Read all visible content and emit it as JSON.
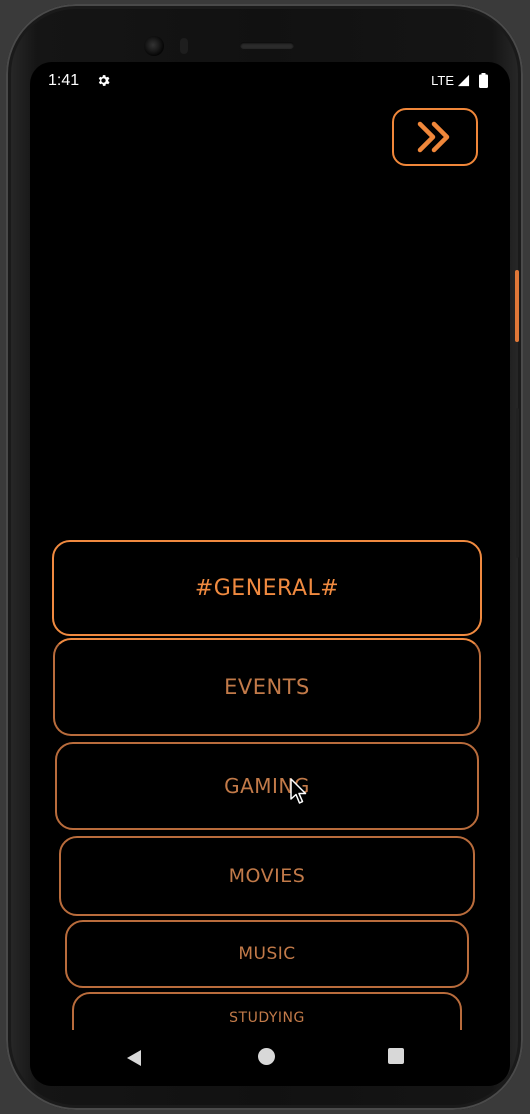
{
  "status_bar": {
    "time": "1:41",
    "network": "LTE"
  },
  "next_button": {
    "icon": "double-chevron-right-icon"
  },
  "channels": [
    {
      "label": "#GENERAL#",
      "active": true
    },
    {
      "label": "EVENTS",
      "active": false
    },
    {
      "label": "GAMING",
      "active": false
    },
    {
      "label": "MOVIES",
      "active": false
    },
    {
      "label": "MUSIC",
      "active": false
    },
    {
      "label": "STUDYING",
      "active": false
    }
  ],
  "colors": {
    "accent": "#f08a40",
    "accent_dim": "#c27a49",
    "background": "#000000"
  }
}
